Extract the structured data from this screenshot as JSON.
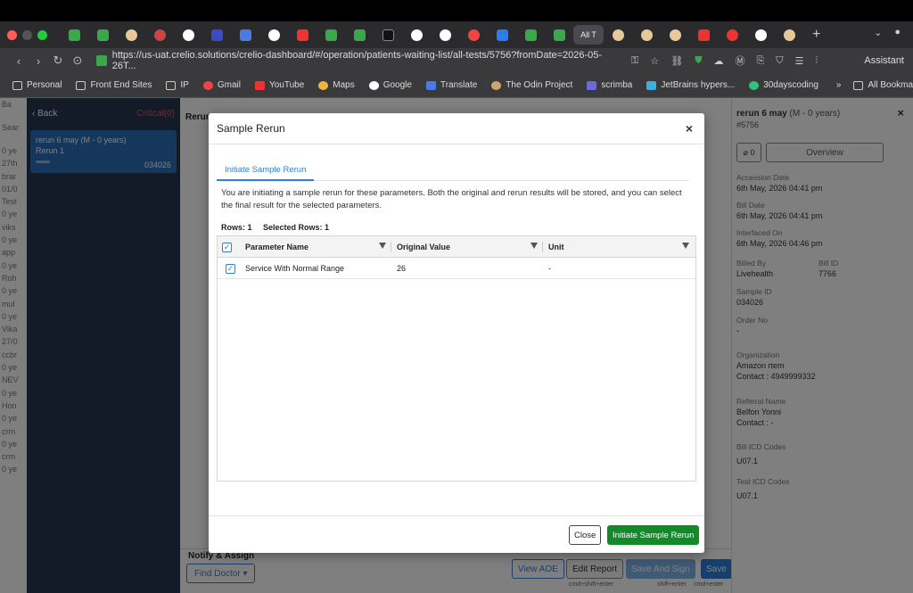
{
  "browser": {
    "active_tab_label": "All T",
    "url": "https://us-uat.crelio.solutions/crelio-dashboard/#/operation/patients-waiting-list/all-tests/5756?fromDate=2026-05-26T...",
    "assistant_label": "Assistant",
    "bookmarks": [
      "Personal",
      "Front End Sites",
      "IP",
      "Gmail",
      "YouTube",
      "Maps",
      "Google",
      "Translate",
      "The Odin Project",
      "scrimba",
      "JetBrains hypers...",
      "30dayscoding"
    ],
    "all_bookmarks_label": "All Bookmarks"
  },
  "colors": {
    "accent": "#2d7fd7",
    "success": "#128a2a",
    "sidebar": "#24364f"
  },
  "far_left": [
    "Ba",
    "Sear",
    "0 ye",
    "27th",
    "brar",
    "01/0",
    "Test",
    "0 ye",
    "viks",
    "0 ye",
    "app",
    "0 ye",
    "Roh",
    "0 ye",
    "mul",
    "0 ye",
    "Vika",
    "27/0",
    "ccbr",
    "0 ye",
    "NEV",
    "0 ye",
    "Hon",
    "0 ye",
    "crm",
    "0 ye",
    "crm",
    "0 ye"
  ],
  "left_panel": {
    "back_label": "Back",
    "critical_label": "Critical(0)",
    "card": {
      "title": "rerun 6 may (M - 0 years)",
      "subtitle": "Rerun 1",
      "accession": "034026"
    }
  },
  "mid": {
    "rerun_label": "Rerun",
    "notify_label": "Notify & Assign",
    "find_doctor_label": "Find Doctor ▾",
    "view_aoe_label": "View AOE",
    "edit_report_label": "Edit Report",
    "save_sign_label": "Save And Sign",
    "save_label": "Save",
    "edit_hint": "cmd+shift+enter",
    "sign_hint": "shift+enter",
    "save_hint": "cmd+enter"
  },
  "right_panel": {
    "title": "rerun 6 may",
    "title_sub": "(M - 0 years)",
    "id": "#5756",
    "attachments": "0",
    "overview_label": "Overview",
    "fields": [
      {
        "label": "Accession Date",
        "value": "6th May, 2026 04:41 pm"
      },
      {
        "label": "Bill Date",
        "value": "6th May, 2026 04:41 pm"
      },
      {
        "label": "Interfaced On",
        "value": "6th May, 2026 04:46 pm"
      },
      {
        "label": "Billed By",
        "value": "Livehealth"
      },
      {
        "label": "Sample ID",
        "value": "034026"
      },
      {
        "label": "Order No",
        "value": "-"
      },
      {
        "label": "Organization",
        "value": "Amazon rtem"
      },
      {
        "label": "Referral Name",
        "value": "Belfon Yonni"
      },
      {
        "label": "Bill ICD Codes",
        "value": "U07.1"
      },
      {
        "label": "Test ICD Codes",
        "value": "U07.1"
      }
    ],
    "bill_id_label": "Bill ID",
    "bill_id_value": "7766",
    "org_contact": "Contact : 4949999332",
    "ref_contact": "Contact : -"
  },
  "modal": {
    "title": "Sample Rerun",
    "tab_label": "Initiate Sample Rerun",
    "description": "You are initiating a sample rerun for these parameters. Both the original and rerun results will be stored, and you can select the final result for the selected parameters.",
    "rows_label": "Rows: 1",
    "selected_rows_label": "Selected Rows: 1",
    "columns": [
      "Parameter Name",
      "Original Value",
      "Unit"
    ],
    "rows": [
      {
        "parameter": "Service With Normal Range",
        "original_value": "26",
        "unit": "-"
      }
    ],
    "close_label": "Close",
    "initiate_label": "Initiate Sample Rerun"
  }
}
